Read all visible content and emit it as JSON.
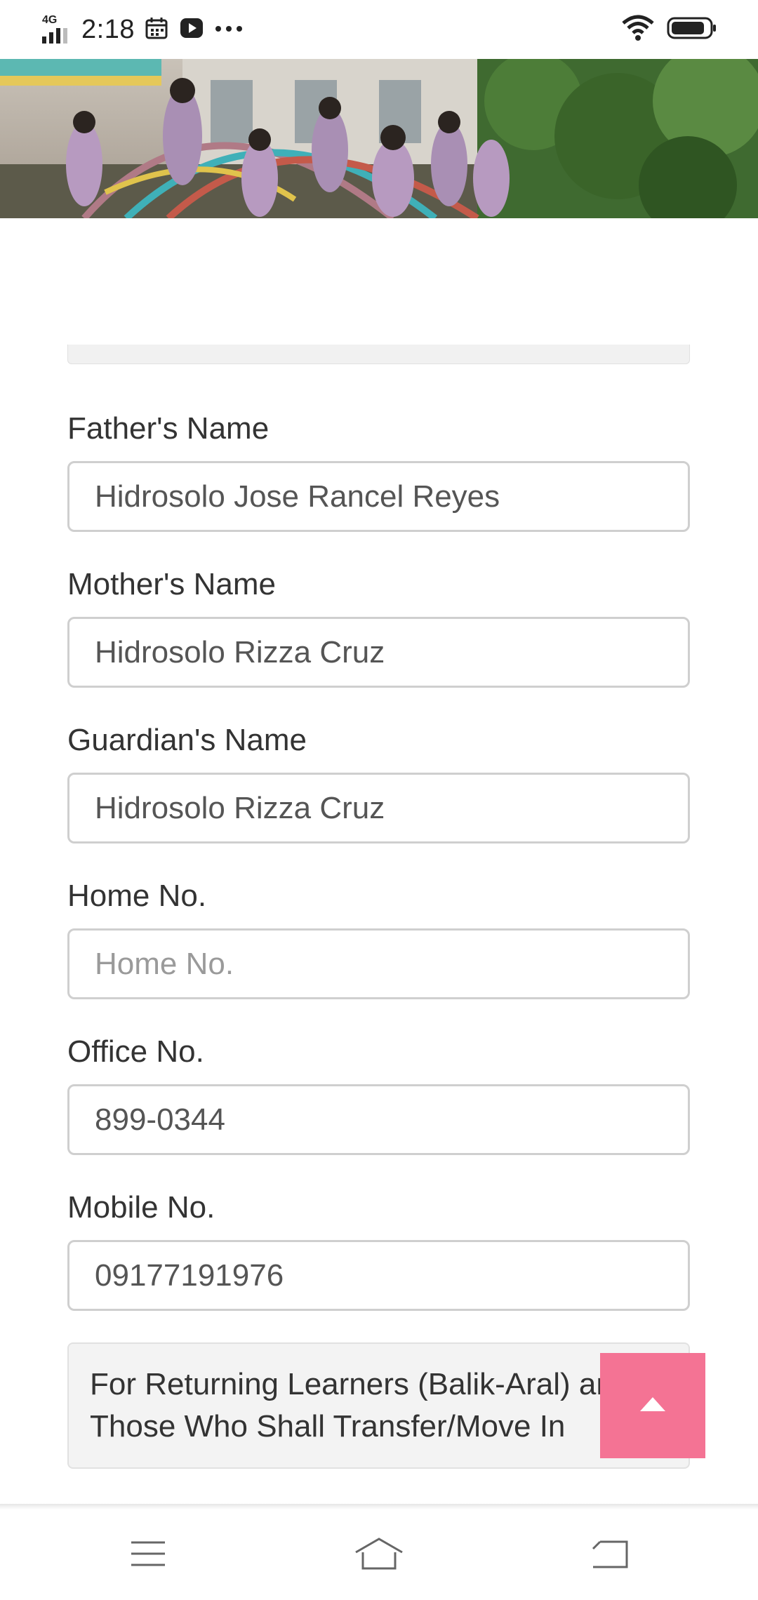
{
  "status_bar": {
    "network": "4G",
    "time": "2:18",
    "icons": [
      "signal-icon",
      "calendar-icon",
      "play-icon",
      "more-icon",
      "wifi-icon",
      "battery-icon"
    ]
  },
  "hero": {
    "icon": "school-playground-photo"
  },
  "form": {
    "fields": [
      {
        "label": "Father's Name",
        "value": "Hidrosolo Jose Rancel Reyes",
        "placeholder": ""
      },
      {
        "label": "Mother's Name",
        "value": "Hidrosolo Rizza Cruz",
        "placeholder": ""
      },
      {
        "label": "Guardian's Name",
        "value": "Hidrosolo Rizza Cruz",
        "placeholder": ""
      },
      {
        "label": "Home No.",
        "value": "",
        "placeholder": "Home No."
      },
      {
        "label": "Office No.",
        "value": "899-0344",
        "placeholder": ""
      },
      {
        "label": "Mobile No.",
        "value": "09177191976",
        "placeholder": ""
      }
    ],
    "returning_panel": {
      "line1": "For Returning Learners (Balik-Aral) and",
      "line2": "Those Who Shall Transfer/Move In"
    }
  },
  "back_to_top": {
    "icon": "chevron-up-icon",
    "color": "#f47394"
  },
  "nav_bar": {
    "icons": [
      "menu-icon",
      "home-icon",
      "back-icon"
    ]
  }
}
